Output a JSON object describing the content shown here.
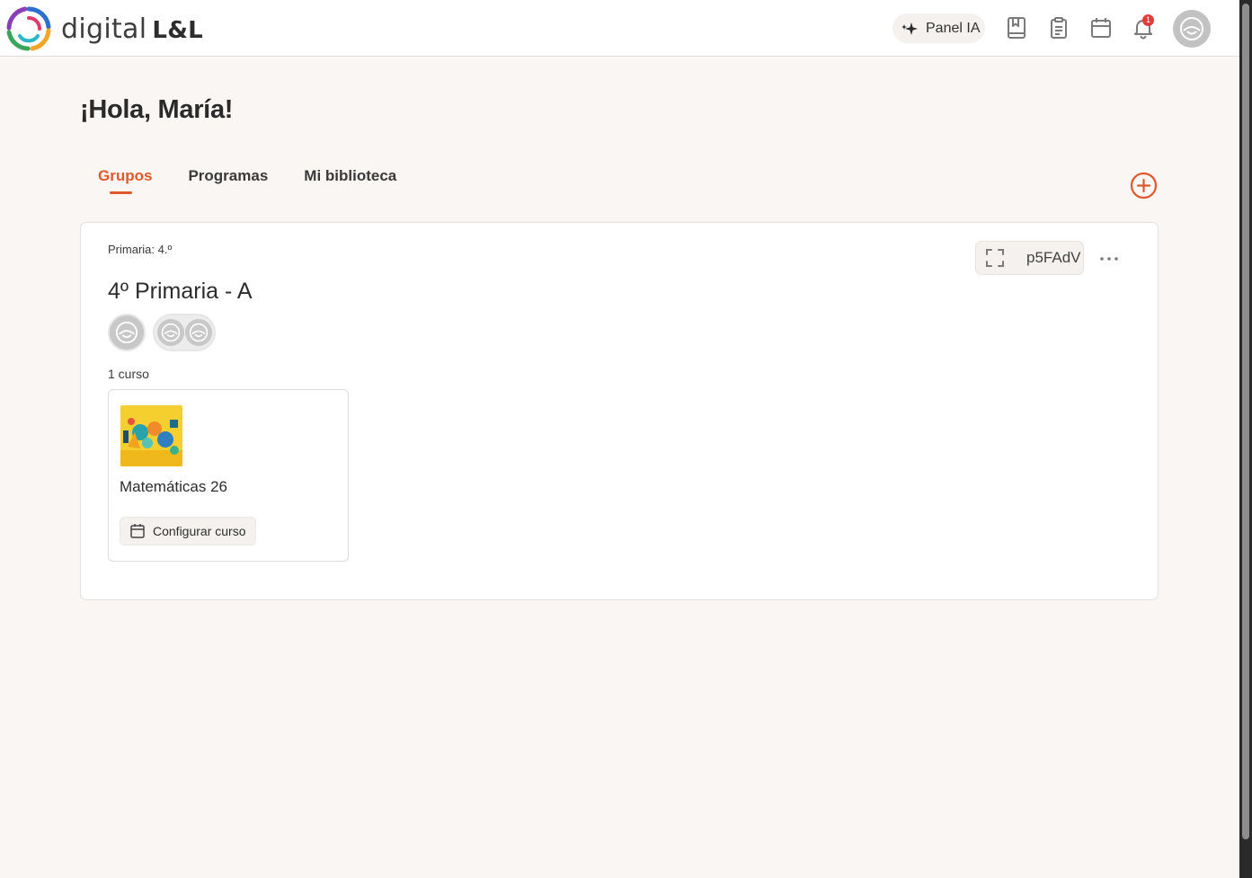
{
  "header": {
    "logo_text": "digital",
    "logo_suffix": "L&L",
    "panel_ia_label": "Panel IA",
    "notification_count": "1",
    "icons": [
      "sparkle-icon",
      "book-icon",
      "clipboard-icon",
      "calendar-icon",
      "bell-icon",
      "user-avatar-icon"
    ]
  },
  "greeting": "¡Hola, María!",
  "tabs": [
    {
      "label": "Grupos",
      "active": true
    },
    {
      "label": "Programas",
      "active": false
    },
    {
      "label": "Mi biblioteca",
      "active": false
    }
  ],
  "group": {
    "level": "Primaria: 4.º",
    "title": "4º Primaria - A",
    "code": "p5FAdV",
    "course_count": "1 curso",
    "courses": [
      {
        "name": "Matemáticas 26",
        "config_label": "Configurar curso"
      }
    ]
  },
  "colors": {
    "accent": "#e0582b",
    "background": "#f9f6f3",
    "badge": "#e23b3b"
  }
}
